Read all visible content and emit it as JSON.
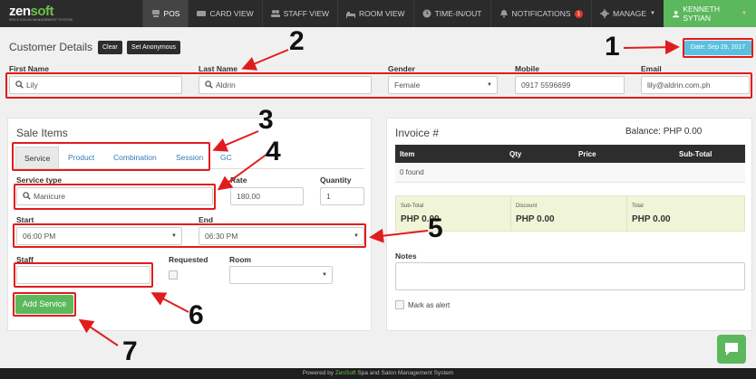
{
  "app": {
    "logo_brand_a": "zen",
    "logo_brand_b": "soft",
    "logo_tagline": "SPA & SALON MANAGEMENT SYSTEM"
  },
  "nav": {
    "items": [
      {
        "label": "POS",
        "icon": "pos-icon"
      },
      {
        "label": "CARD VIEW",
        "icon": "card-icon"
      },
      {
        "label": "STAFF VIEW",
        "icon": "staff-icon"
      },
      {
        "label": "ROOM VIEW",
        "icon": "bed-icon"
      },
      {
        "label": "TIME-IN/OUT",
        "icon": "clock-icon"
      },
      {
        "label": "NOTIFICATIONS",
        "icon": "bell-icon",
        "badge": "1"
      },
      {
        "label": "MANAGE",
        "icon": "gear-icon"
      }
    ],
    "user_name": "KENNETH SYTIAN"
  },
  "customer": {
    "title": "Customer Details",
    "clear_label": "Clear",
    "anonymous_label": "Set Anonymous",
    "date": "Date: Sep 29, 2017",
    "labels": {
      "first_name": "First Name",
      "last_name": "Last Name",
      "gender": "Gender",
      "mobile": "Mobile",
      "email": "Email"
    },
    "values": {
      "first_name": "Lily",
      "last_name": "Aldrin",
      "gender": "Female",
      "mobile": "0917 5596699",
      "email": "lily@aldrin.com.ph"
    }
  },
  "sale": {
    "title": "Sale Items",
    "tabs": [
      "Service",
      "Product",
      "Combination",
      "Session",
      "GC"
    ],
    "labels": {
      "service_type": "Service type",
      "rate": "Rate",
      "quantity": "Quantity",
      "start": "Start",
      "end": "End",
      "staff": "Staff",
      "requested": "Requested",
      "room": "Room"
    },
    "values": {
      "service_type": "Manicure",
      "rate": "180.00",
      "quantity": "1",
      "start": "06:00 PM",
      "end": "06:30 PM",
      "staff": "",
      "room": ""
    },
    "add_button": "Add Service"
  },
  "invoice": {
    "title": "Invoice #",
    "balance": "Balance: PHP 0.00",
    "columns": [
      "Item",
      "Qty",
      "Price",
      "Sub-Total"
    ],
    "empty_text": "0 found",
    "totals": [
      {
        "label": "Sub-Total",
        "value": "PHP 0.00"
      },
      {
        "label": "Discount",
        "value": "PHP 0.00"
      },
      {
        "label": "Total",
        "value": "PHP 0.00"
      }
    ],
    "notes_label": "Notes",
    "alert_label": "Mark as alert"
  },
  "annotations": [
    "1",
    "2",
    "3",
    "4",
    "5",
    "6",
    "7"
  ],
  "footer": {
    "prefix": "Powered by ",
    "brand": "ZenSoft",
    "suffix": " Spa and Salon Management System"
  },
  "colors": {
    "accent_green": "#5cb85c",
    "date_badge": "#5bc0de",
    "annotation_red": "#e11c1c",
    "navbar": "#2b2b2b"
  }
}
